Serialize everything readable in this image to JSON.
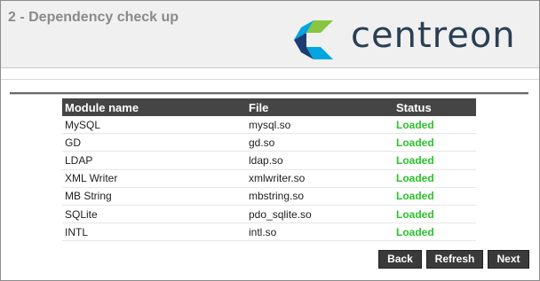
{
  "step_title": "2 - Dependency check up",
  "brand": {
    "name": "centreon",
    "color": "#2a3f54",
    "mark_colors": [
      "#88c540",
      "#00a6e0",
      "#1e3c72"
    ]
  },
  "table": {
    "headers": [
      "Module name",
      "File",
      "Status"
    ],
    "rows": [
      {
        "module": "MySQL",
        "file": "mysql.so",
        "status": "Loaded"
      },
      {
        "module": "GD",
        "file": "gd.so",
        "status": "Loaded"
      },
      {
        "module": "LDAP",
        "file": "ldap.so",
        "status": "Loaded"
      },
      {
        "module": "XML Writer",
        "file": "xmlwriter.so",
        "status": "Loaded"
      },
      {
        "module": "MB String",
        "file": "mbstring.so",
        "status": "Loaded"
      },
      {
        "module": "SQLite",
        "file": "pdo_sqlite.so",
        "status": "Loaded"
      },
      {
        "module": "INTL",
        "file": "intl.so",
        "status": "Loaded"
      }
    ],
    "status_color": "#2bc12b"
  },
  "buttons": {
    "back": "Back",
    "refresh": "Refresh",
    "next": "Next"
  }
}
